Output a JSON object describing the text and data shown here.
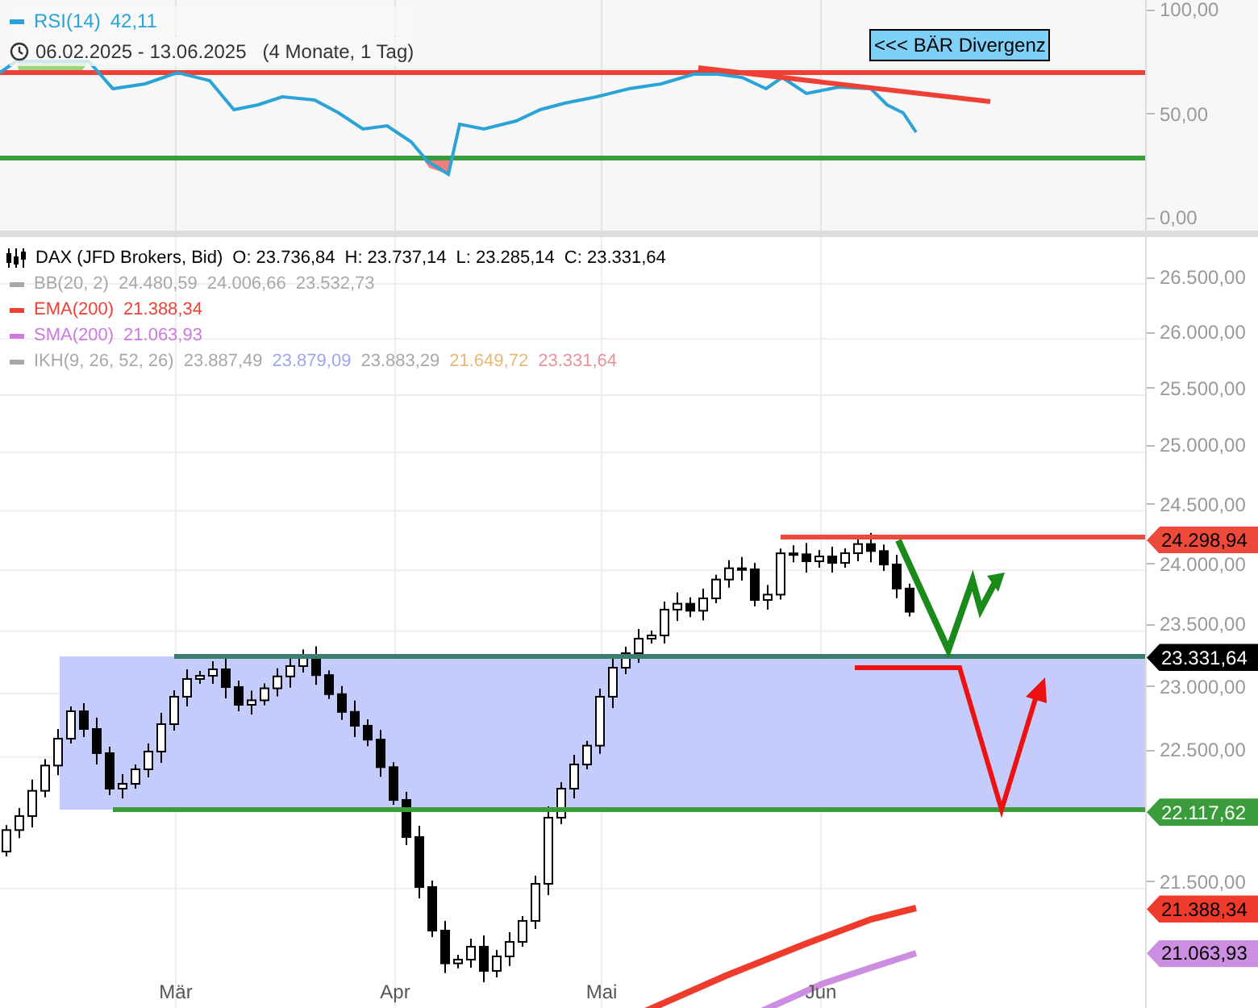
{
  "rsi_panel": {
    "legend": {
      "name": "RSI(14)",
      "value": "42,11",
      "color": "#2aa3d6"
    },
    "date_range": "06.02.2025 - 13.06.2025",
    "period": "(4 Monate, 1 Tag)",
    "annotation": "<<< BÄR Divergenz",
    "axis_ticks": [
      "100,00",
      "50,00",
      "0,00"
    ]
  },
  "price_panel": {
    "instrument": {
      "title": "DAX (JFD Brokers, Bid)",
      "ohlc": [
        "O: 23.736,84",
        "H: 23.737,14",
        "L: 23.285,14",
        "C: 23.331,64"
      ]
    },
    "indicators": [
      {
        "name": "BB(20, 2)",
        "color": "#a8a8a8",
        "values": [
          {
            "text": "24.480,59",
            "color": "#a8a8a8"
          },
          {
            "text": "24.006,66",
            "color": "#a8a8a8"
          },
          {
            "text": "23.532,73",
            "color": "#a8a8a8"
          }
        ]
      },
      {
        "name": "EMA(200)",
        "color": "#ee4035",
        "values": [
          {
            "text": "21.388,34",
            "color": "#ee4035"
          }
        ]
      },
      {
        "name": "SMA(200)",
        "color": "#cc7ae0",
        "values": [
          {
            "text": "21.063,93",
            "color": "#cc7ae0"
          }
        ]
      },
      {
        "name": "IKH(9, 26, 52, 26)",
        "color": "#a8a8a8",
        "values": [
          {
            "text": "23.887,49",
            "color": "#a8a8a8"
          },
          {
            "text": "23.879,09",
            "color": "#9ea6f0"
          },
          {
            "text": "23.883,29",
            "color": "#a8a8a8"
          },
          {
            "text": "21.649,72",
            "color": "#e8b878"
          },
          {
            "text": "23.331,64",
            "color": "#e8929c"
          }
        ]
      }
    ],
    "axis_ticks": [
      "26.500,00",
      "26.000,00",
      "25.500,00",
      "25.000,00",
      "24.500,00",
      "24.000,00",
      "23.500,00",
      "23.000,00",
      "22.500,00",
      "21.500,00"
    ],
    "price_tags": [
      {
        "text": "24.298,94",
        "color": "#ee4a3b"
      },
      {
        "text": "23.331,64",
        "color": "#000000"
      },
      {
        "text": "22.117,62",
        "color": "#3a9c3a"
      },
      {
        "text": "21.388,34",
        "color": "#ee3b2b"
      },
      {
        "text": "21.063,93",
        "color": "#cc8ee0"
      }
    ],
    "x_labels": [
      "Mär",
      "Apr",
      "Mai",
      "Jun"
    ]
  }
}
